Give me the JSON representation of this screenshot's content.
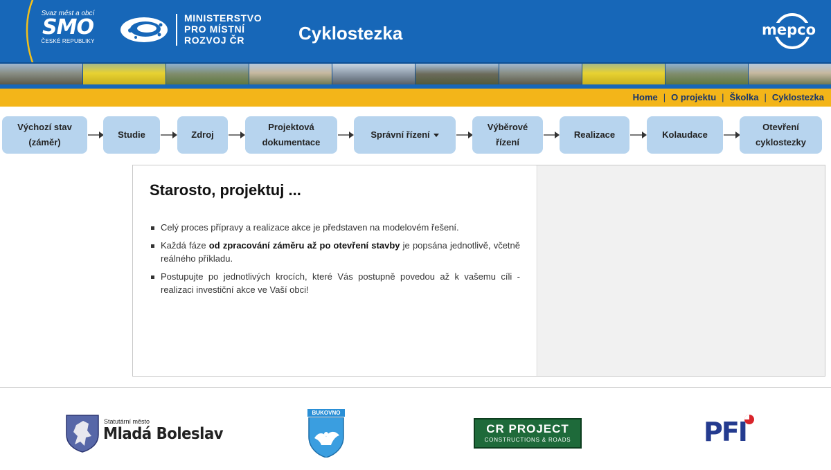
{
  "header": {
    "smo": {
      "top": "Svaz měst a obcí",
      "main": "SMO",
      "bottom": "ČESKÉ REPUBLIKY"
    },
    "ministry": {
      "line1": "MINISTERSTVO",
      "line2": "PRO MÍSTNÍ",
      "line3": "ROZVOJ ČR"
    },
    "site_title": "Cyklostezka",
    "partner_logo": "mepco"
  },
  "top_nav": {
    "items": [
      {
        "label": "Home"
      },
      {
        "label": "O projektu"
      },
      {
        "label": "Školka"
      },
      {
        "label": "Cyklostezka"
      }
    ],
    "separator": "|"
  },
  "steps": [
    {
      "label": "Výchozí stav (záměr)"
    },
    {
      "label": "Studie"
    },
    {
      "label": "Zdroj"
    },
    {
      "label": "Projektová dokumentace"
    },
    {
      "label": "Správní řízení",
      "has_dropdown": true
    },
    {
      "label": "Výběrové řízení"
    },
    {
      "label": "Realizace"
    },
    {
      "label": "Kolaudace"
    },
    {
      "label": "Otevření cyklostezky"
    }
  ],
  "main": {
    "title": "Starosto, projektuj ...",
    "bullets": [
      {
        "text": "Celý proces přípravy a realizace akce je představen na modelovém řešení."
      },
      {
        "pre": "Každá fáze ",
        "bold": "od zpracování záměru až po otevření stavby",
        "post": " je popsána jednotlivě, včetně reálného příkladu."
      },
      {
        "text": "Postupujte po jednotlivých krocích, které Vás postupně povedou až k vašemu cíli - realizaci investiční akce ve Vaší obci!"
      }
    ]
  },
  "footer_partners": {
    "mlada_boleslav": {
      "small": "Statutární město",
      "big": "Mladá Boleslav"
    },
    "bukovno": {
      "label": "BUKOVNO"
    },
    "cr_project": {
      "line1": "CR PROJECT",
      "line2": "CONSTRUCTIONS & ROADS"
    },
    "pfi": {
      "label": "PFI"
    }
  },
  "colors": {
    "header_blue": "#1767b8",
    "nav_yellow": "#f3b519",
    "step_bg": "#b7d4ee",
    "nav_text": "#17346b"
  }
}
